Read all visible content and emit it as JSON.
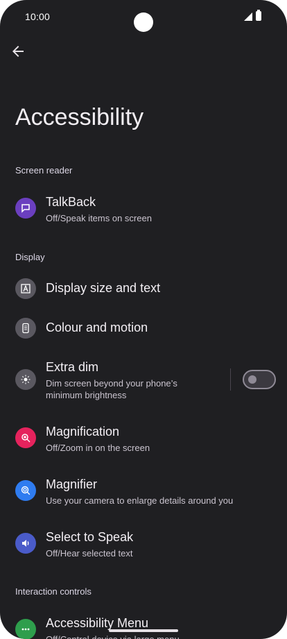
{
  "status": {
    "time": "10:00"
  },
  "header": {
    "title": "Accessibility"
  },
  "sections": {
    "screen_reader": "Screen reader",
    "display": "Display",
    "interaction": "Interaction controls"
  },
  "items": {
    "talkback": {
      "label": "TalkBack",
      "sub": "Off/Speak items on screen",
      "color": "#6b3fbf",
      "icon": "chat-icon"
    },
    "display_size": {
      "label": "Display size and text",
      "color": "#5a5860",
      "icon": "text-a-icon"
    },
    "colour_motion": {
      "label": "Colour and motion",
      "color": "#5a5860",
      "icon": "phone-icon"
    },
    "extra_dim": {
      "label": "Extra dim",
      "sub1": "Dim screen beyond your phone’s",
      "sub2": "minimum brightness",
      "color": "#5a5860",
      "icon": "brightness-icon",
      "toggle_on": false
    },
    "magnification": {
      "label": "Magnification",
      "sub": "Off/Zoom in on the screen",
      "color": "#e5235d",
      "icon": "zoom-icon"
    },
    "magnifier": {
      "label": "Magnifier",
      "sub": "Use your camera to enlarge details around you",
      "color": "#2f7cf0",
      "icon": "magnifier-icon"
    },
    "select_to_speak": {
      "label": "Select to Speak",
      "sub": "Off/Hear selected text",
      "color": "#4a5bc9",
      "icon": "speaker-icon"
    },
    "accessibility_menu": {
      "label": "Accessibility Menu",
      "sub": "Off/Control device via large menu",
      "color": "#2e9e4c",
      "icon": "dots-icon"
    }
  }
}
